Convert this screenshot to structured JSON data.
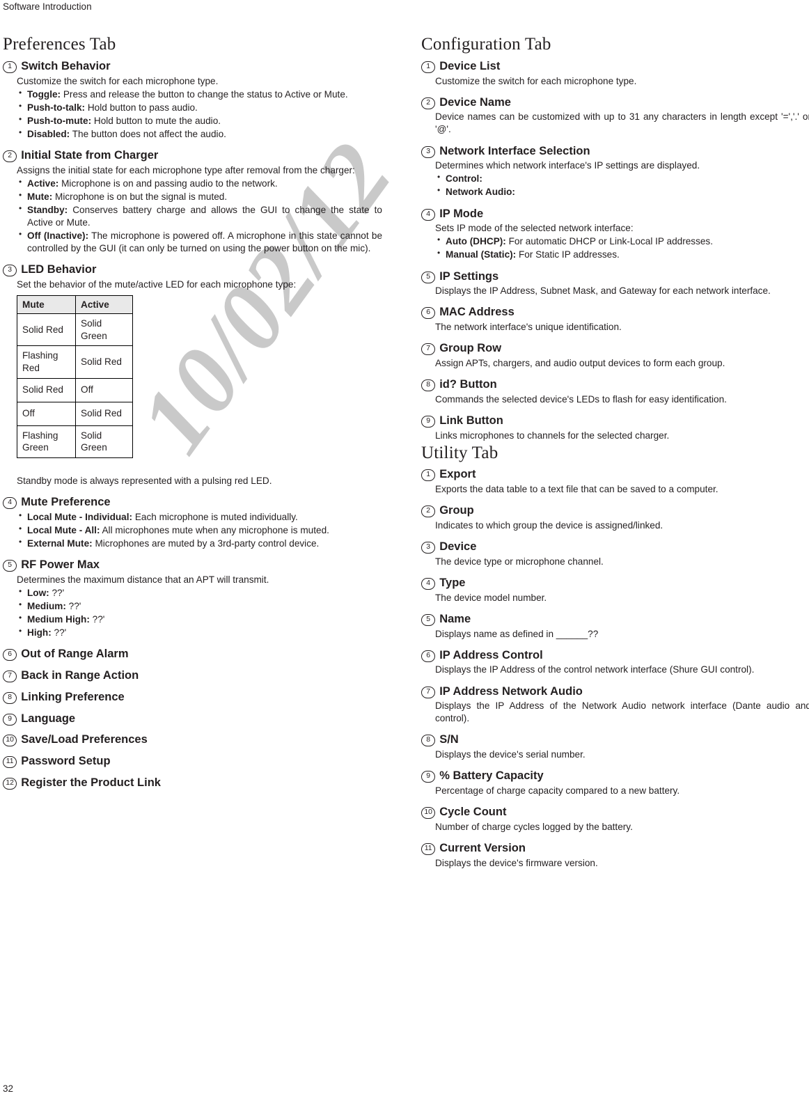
{
  "running_head": "Software Introduction",
  "page_number": "32",
  "watermark": "10/02/12",
  "left_column": {
    "tab_title": "Preferences Tab",
    "entries": [
      {
        "num": "1",
        "title": "Switch Behavior",
        "intro": "Customize the switch for each microphone type.",
        "bullets": [
          {
            "label": "Toggle:",
            "text": "Press and release the button to change the status to Active or Mute."
          },
          {
            "label": "Push-to-talk:",
            "text": "Hold button to pass audio."
          },
          {
            "label": "Push-to-mute:",
            "text": "Hold button to mute the audio."
          },
          {
            "label": "Disabled:",
            "text": "The button does not affect the audio."
          }
        ]
      },
      {
        "num": "2",
        "title": "Initial State from Charger",
        "intro": "Assigns the initial state for each microphone type after removal from the charger:",
        "bullets": [
          {
            "label": "Active:",
            "text": "Microphone is on and passing audio to the network."
          },
          {
            "label": "Mute:",
            "text": "Microphone is on but the signal is muted."
          },
          {
            "label": "Standby:",
            "text": "Conserves battery charge and allows the GUI to change the state to Active or Mute."
          },
          {
            "label": "Off (Inactive):",
            "text": "The microphone is powered off. A microphone in this state cannot be controlled by the GUI (it can only be turned on using the power button on the mic)."
          }
        ]
      },
      {
        "num": "3",
        "title": "LED Behavior",
        "intro": "Set the behavior of the mute/active LED for each microphone type:",
        "table": {
          "headers": [
            "Mute",
            "Active"
          ],
          "rows": [
            [
              "Solid Red",
              "Solid Green"
            ],
            [
              "Flashing Red",
              "Solid Red"
            ],
            [
              "Solid Red",
              "Off"
            ],
            [
              "Off",
              "Solid Red"
            ],
            [
              "Flashing Green",
              "Solid Green"
            ]
          ]
        },
        "note": "Standby mode is always represented with a pulsing red LED."
      },
      {
        "num": "4",
        "title": "Mute Preference",
        "bullets": [
          {
            "label": "Local Mute - Individual:",
            "text": "Each microphone is muted individually."
          },
          {
            "label": "Local Mute - All:",
            "text": "All microphones mute when any microphone is muted."
          },
          {
            "label": "External Mute:",
            "text": "Microphones are muted by a 3rd-party control device."
          }
        ]
      },
      {
        "num": "5",
        "title": "RF Power Max",
        "intro": "Determines the maximum distance that an APT will transmit.",
        "bullets": [
          {
            "label": "Low:",
            "text": "??'"
          },
          {
            "label": "Medium:",
            "text": "??'"
          },
          {
            "label": "Medium High:",
            "text": "??'"
          },
          {
            "label": "High:",
            "text": "??'"
          }
        ]
      },
      {
        "num": "6",
        "title": "Out of Range Alarm"
      },
      {
        "num": "7",
        "title": "Back in Range Action"
      },
      {
        "num": "8",
        "title": "Linking Preference"
      },
      {
        "num": "9",
        "title": "Language"
      },
      {
        "num": "10",
        "title": "Save/Load Preferences"
      },
      {
        "num": "11",
        "title": "Password Setup"
      },
      {
        "num": "12",
        "title": "Register the Product Link"
      }
    ]
  },
  "right_column": {
    "config_tab_title": "Configuration Tab",
    "config_entries": [
      {
        "num": "1",
        "title": "Device List",
        "intro": "Customize the switch for each microphone type."
      },
      {
        "num": "2",
        "title": "Device Name",
        "intro": "Device names can be customized with up to 31 any characters in length except '=','.' or '@'."
      },
      {
        "num": "3",
        "title": "Network Interface Selection",
        "intro": "Determines which network interface's IP settings are displayed.",
        "bullets": [
          {
            "label": "Control:",
            "text": ""
          },
          {
            "label": "Network Audio:",
            "text": ""
          }
        ]
      },
      {
        "num": "4",
        "title": "IP Mode",
        "intro": "Sets IP mode of the selected network interface:",
        "bullets": [
          {
            "label": "Auto (DHCP):",
            "text": "For automatic DHCP or Link-Local IP addresses."
          },
          {
            "label": "Manual (Static):",
            "text": "For Static IP addresses."
          }
        ]
      },
      {
        "num": "5",
        "title": "IP Settings",
        "intro": "Displays the IP Address, Subnet Mask, and Gateway for each network interface."
      },
      {
        "num": "6",
        "title": "MAC Address",
        "intro": "The network interface's unique identification."
      },
      {
        "num": "7",
        "title": "Group Row",
        "intro": "Assign APTs, chargers, and audio output devices to form each group."
      },
      {
        "num": "8",
        "title": "id? Button",
        "intro": "Commands the selected device's LEDs to flash for easy identification."
      },
      {
        "num": "9",
        "title": "Link Button",
        "intro": "Links microphones to channels for the selected charger."
      }
    ],
    "utility_tab_title": "Utility Tab",
    "utility_entries": [
      {
        "num": "1",
        "title": "Export",
        "intro": "Exports the data table to a text file that can be saved to a computer."
      },
      {
        "num": "2",
        "title": "Group",
        "intro": "Indicates to which group the device is assigned/linked."
      },
      {
        "num": "3",
        "title": "Device",
        "intro": "The device type or microphone channel."
      },
      {
        "num": "4",
        "title": "Type",
        "intro": "The device model number."
      },
      {
        "num": "5",
        "title": "Name",
        "intro": "Displays name as defined in ______??"
      },
      {
        "num": "6",
        "title": "IP Address Control",
        "intro": "Displays the IP Address of the control network interface (Shure GUI control)."
      },
      {
        "num": "7",
        "title": "IP Address Network Audio",
        "intro": "Displays the IP Address of the Network Audio network interface (Dante audio and control)."
      },
      {
        "num": "8",
        "title": "S/N",
        "intro": "Displays the device's serial number."
      },
      {
        "num": "9",
        "title": "% Battery Capacity",
        "intro": "Percentage of charge capacity compared to a new battery."
      },
      {
        "num": "10",
        "title": "Cycle Count",
        "intro": "Number of charge cycles logged by the battery."
      },
      {
        "num": "11",
        "title": "Current Version",
        "intro": "Displays the device's firmware version."
      }
    ]
  }
}
